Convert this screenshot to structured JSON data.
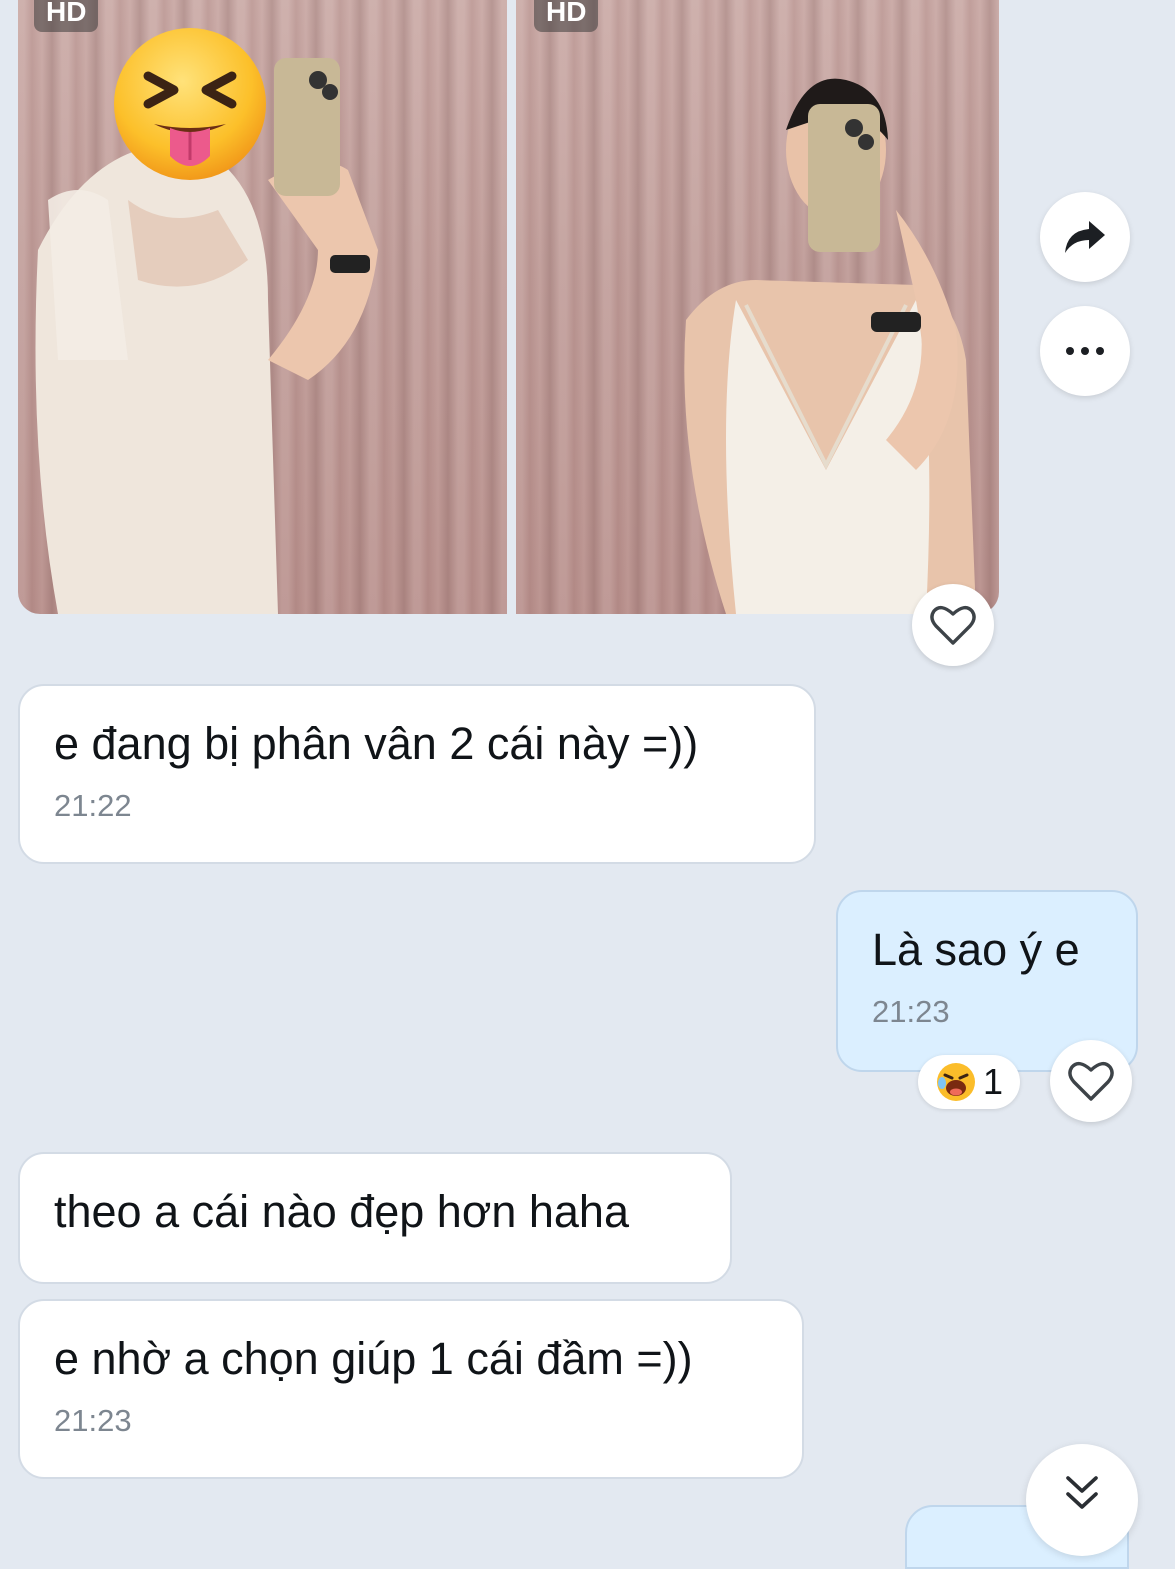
{
  "photos": [
    {
      "badge": "HD"
    },
    {
      "badge": "HD"
    }
  ],
  "photo_actions": {
    "share_icon": "share-arrow-icon",
    "more_icon": "more-dots-icon",
    "heart_icon": "heart-outline-icon"
  },
  "messages": [
    {
      "side": "received",
      "text": "e đang bị phân vân 2 cái này =))",
      "time": "21:22"
    },
    {
      "side": "sent",
      "text": "Là sao ý e",
      "time": "21:23",
      "reaction": {
        "emoji": "laughing-emoji",
        "count": "1"
      }
    },
    {
      "side": "received",
      "text": "theo a cái nào đẹp hơn haha"
    },
    {
      "side": "received",
      "text": "e nhờ a chọn giúp 1 cái đầm =))",
      "time": "21:23"
    }
  ],
  "scroll_button": {
    "icon": "double-chevron-down-icon"
  },
  "colors": {
    "background": "#e3e9f1",
    "sent_bubble": "#dbefff",
    "received_bubble": "#ffffff",
    "time_text": "#7d8690"
  }
}
